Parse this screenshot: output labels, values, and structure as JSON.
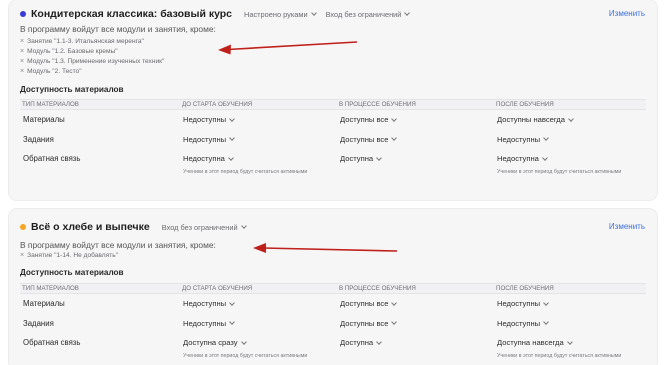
{
  "columns": [
    "ТИП МАТЕРИАЛОВ",
    "ДО СТАРТА ОБУЧЕНИЯ",
    "В ПРОЦЕССЕ ОБУЧЕНИЯ",
    "ПОСЛЕ ОБУЧЕНИЯ"
  ],
  "colors": {
    "course1_dot": "#3b3bd8",
    "course2_dot": "#f5a623",
    "link": "#3b6fd8",
    "arrow": "#c0201a"
  },
  "courses": [
    {
      "title": "Кондитерская классика: базовый курс",
      "chips": [
        "Настроено руками",
        "Вход без ограничений"
      ],
      "edit": "Изменить",
      "program_note": "В программу войдут все модули и занятия, кроме:",
      "exclusions": [
        "Занятие \"1.1-3. Итальянская меренга\"",
        "Модуль \"1.2. Базовые кремы\"",
        "Модуль \"1.3. Применение изученных техник\"",
        "Модуль \"2. Тесто\""
      ],
      "access_title": "Доступность материалов",
      "rows": [
        {
          "label": "Материалы",
          "before": "Недоступны",
          "during": "Доступны все",
          "after": "Доступны навсегда"
        },
        {
          "label": "Задания",
          "before": "Недоступны",
          "during": "Доступны все",
          "after": "Недоступны"
        },
        {
          "label": "Обратная связь",
          "before": "Недоступна",
          "during": "Доступна",
          "after": "Недоступна"
        }
      ],
      "active_note_before": "Ученики в этот период будут считаться активными",
      "active_note_after": "Ученики в этот период будут считаться активными"
    },
    {
      "title": "Всё о хлебе и выпечке",
      "chips": [
        "Вход без ограничений"
      ],
      "edit": "Изменить",
      "program_note": "В программу войдут все модули и занятия, кроме:",
      "exclusions": [
        "Занятие \"1-14. Не добавлять\""
      ],
      "access_title": "Доступность материалов",
      "rows": [
        {
          "label": "Материалы",
          "before": "Недоступны",
          "during": "Доступны все",
          "after": "Недоступны"
        },
        {
          "label": "Задания",
          "before": "Недоступны",
          "during": "Доступны все",
          "after": "Недоступны"
        },
        {
          "label": "Обратная связь",
          "before": "Доступна сразу",
          "during": "Доступна",
          "after": "Доступна навсегда"
        }
      ],
      "active_note_before": "Ученики в этот период будут считаться активными",
      "active_note_after": "Ученики в этот период будут считаться активными"
    }
  ]
}
